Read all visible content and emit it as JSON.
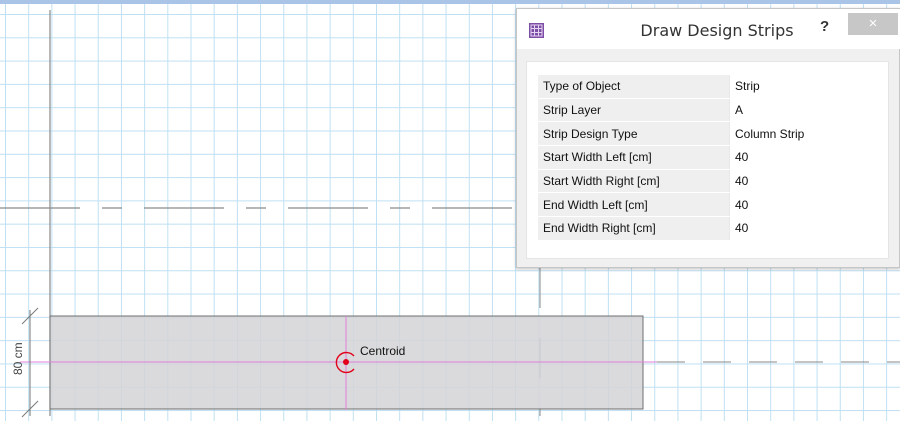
{
  "dialog": {
    "title": "Draw Design Strips",
    "help_label": "?",
    "close_label": "×",
    "properties": [
      {
        "key": "Type of Object",
        "value": "Strip"
      },
      {
        "key": "Strip Layer",
        "value": "A"
      },
      {
        "key": "Strip Design Type",
        "value": "Column Strip"
      },
      {
        "key": "Start Width Left  [cm]",
        "value": "40"
      },
      {
        "key": "Start Width Right  [cm]",
        "value": "40"
      },
      {
        "key": "End Width Left  [cm]",
        "value": "40"
      },
      {
        "key": "End Width Right  [cm]",
        "value": "40"
      }
    ]
  },
  "canvas": {
    "centroid_label": "Centroid",
    "dimension_label": "80 cm"
  },
  "colors": {
    "grid": "#bfe0f3",
    "strip_fill": "#d3d3d6",
    "centroid": "#e2001a",
    "axis_line": "#e07fd8"
  }
}
